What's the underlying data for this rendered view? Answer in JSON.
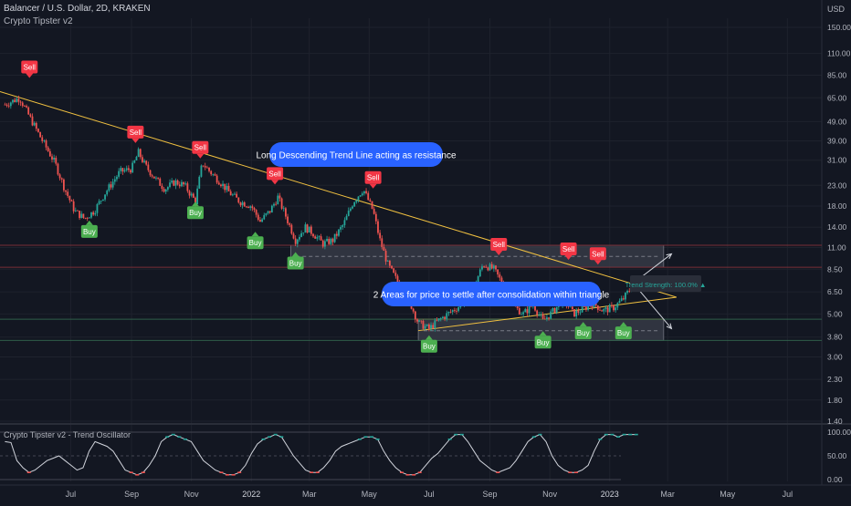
{
  "header": {
    "symbol_line": "Balancer / U.S. Dollar, 2D, KRAKEN",
    "indicator": "Crypto Tipster v2",
    "currency": "USD"
  },
  "oscillator": {
    "title": "Crypto Tipster v2 - Trend Oscillator",
    "ticks": [
      "100.00",
      "50.00",
      "0.00"
    ],
    "values": [
      80,
      78,
      40,
      25,
      15,
      20,
      30,
      40,
      45,
      50,
      40,
      30,
      20,
      25,
      60,
      80,
      75,
      70,
      60,
      40,
      20,
      15,
      10,
      15,
      30,
      50,
      80,
      90,
      95,
      90,
      85,
      80,
      60,
      40,
      30,
      20,
      15,
      10,
      10,
      15,
      30,
      55,
      75,
      85,
      90,
      95,
      90,
      70,
      50,
      35,
      20,
      15,
      15,
      25,
      40,
      60,
      70,
      75,
      80,
      85,
      90,
      90,
      85,
      60,
      40,
      25,
      15,
      10,
      10,
      15,
      30,
      45,
      55,
      70,
      85,
      95,
      95,
      80,
      60,
      40,
      30,
      20,
      15,
      20,
      25,
      40,
      60,
      80,
      90,
      95,
      80,
      50,
      30,
      20,
      15,
      15,
      20,
      30,
      60,
      85,
      95,
      95,
      90,
      95,
      95,
      95
    ]
  },
  "annotations": {
    "resistance_note": "Long Descending Trend Line acting as resistance",
    "areas_note": "2 Areas for price to settle after consolidation within triangle",
    "trend_strength": "Trend Strength: 100.0% ▲"
  },
  "signals": [
    {
      "label": "Sell",
      "color": "#f23645",
      "date": "2021-05-20",
      "price": 78
    },
    {
      "label": "Buy",
      "color": "#4caf50",
      "date": "2021-07-20",
      "price": 16
    },
    {
      "label": "Sell",
      "color": "#f23645",
      "date": "2021-09-05",
      "price": 36
    },
    {
      "label": "Sell",
      "color": "#f23645",
      "date": "2021-11-10",
      "price": 30
    },
    {
      "label": "Buy",
      "color": "#4caf50",
      "date": "2021-11-05",
      "price": 20
    },
    {
      "label": "Buy",
      "color": "#4caf50",
      "date": "2022-01-05",
      "price": 14
    },
    {
      "label": "Sell",
      "color": "#f23645",
      "date": "2022-01-25",
      "price": 22
    },
    {
      "label": "Buy",
      "color": "#4caf50",
      "date": "2022-02-15",
      "price": 11
    },
    {
      "label": "Sell",
      "color": "#f23645",
      "date": "2022-05-05",
      "price": 21
    },
    {
      "label": "Buy",
      "color": "#4caf50",
      "date": "2022-07-01",
      "price": 4.1
    },
    {
      "label": "Sell",
      "color": "#f23645",
      "date": "2022-09-10",
      "price": 9.5
    },
    {
      "label": "Buy",
      "color": "#4caf50",
      "date": "2022-10-25",
      "price": 4.3
    },
    {
      "label": "Sell",
      "color": "#f23645",
      "date": "2022-11-20",
      "price": 9
    },
    {
      "label": "Buy",
      "color": "#4caf50",
      "date": "2022-12-05",
      "price": 4.8
    },
    {
      "label": "Sell",
      "color": "#f23645",
      "date": "2022-12-20",
      "price": 8.5
    },
    {
      "label": "Buy",
      "color": "#4caf50",
      "date": "2023-01-15",
      "price": 4.8
    }
  ],
  "chart_data": {
    "type": "candlestick",
    "x_axis_labels": [
      "Jul",
      "Sep",
      "Nov",
      "2022",
      "Mar",
      "May",
      "Jul",
      "Sep",
      "Nov",
      "2023",
      "Mar",
      "May",
      "Jul"
    ],
    "y_axis_ticks": [
      "150.00",
      "110.00",
      "85.00",
      "65.00",
      "49.00",
      "39.00",
      "31.00",
      "23.00",
      "18.00",
      "14.00",
      "11.00",
      "8.50",
      "6.50",
      "5.00",
      "3.80",
      "3.00",
      "2.30",
      "1.80",
      "1.40"
    ],
    "y_scale": "log",
    "ylim": [
      1.4,
      150
    ],
    "price_path": [
      [
        "2021-04-25",
        60
      ],
      [
        "2021-05-10",
        65
      ],
      [
        "2021-05-20",
        52
      ],
      [
        "2021-06-01",
        40
      ],
      [
        "2021-06-15",
        30
      ],
      [
        "2021-06-25",
        22
      ],
      [
        "2021-07-05",
        17
      ],
      [
        "2021-07-15",
        15.5
      ],
      [
        "2021-07-25",
        17
      ],
      [
        "2021-08-05",
        21
      ],
      [
        "2021-08-20",
        27
      ],
      [
        "2021-09-01",
        28
      ],
      [
        "2021-09-08",
        34
      ],
      [
        "2021-09-15",
        29
      ],
      [
        "2021-09-25",
        25
      ],
      [
        "2021-10-05",
        22
      ],
      [
        "2021-10-15",
        24
      ],
      [
        "2021-10-25",
        23
      ],
      [
        "2021-11-05",
        19
      ],
      [
        "2021-11-12",
        30
      ],
      [
        "2021-11-20",
        27
      ],
      [
        "2021-11-30",
        24
      ],
      [
        "2021-12-10",
        21
      ],
      [
        "2021-12-20",
        19
      ],
      [
        "2022-01-01",
        18
      ],
      [
        "2022-01-10",
        15
      ],
      [
        "2022-01-20",
        17
      ],
      [
        "2022-01-28",
        20
      ],
      [
        "2022-02-05",
        16
      ],
      [
        "2022-02-15",
        12
      ],
      [
        "2022-02-25",
        14
      ],
      [
        "2022-03-05",
        13
      ],
      [
        "2022-03-15",
        11.5
      ],
      [
        "2022-03-25",
        12
      ],
      [
        "2022-04-05",
        14.5
      ],
      [
        "2022-04-15",
        19
      ],
      [
        "2022-04-25",
        22
      ],
      [
        "2022-05-05",
        17
      ],
      [
        "2022-05-12",
        12
      ],
      [
        "2022-05-20",
        9
      ],
      [
        "2022-06-01",
        7
      ],
      [
        "2022-06-10",
        6
      ],
      [
        "2022-06-20",
        4.5
      ],
      [
        "2022-07-01",
        4.2
      ],
      [
        "2022-07-10",
        4.6
      ],
      [
        "2022-07-20",
        5
      ],
      [
        "2022-08-01",
        5.5
      ],
      [
        "2022-08-15",
        6.8
      ],
      [
        "2022-08-25",
        9
      ],
      [
        "2022-09-05",
        8.5
      ],
      [
        "2022-09-15",
        7
      ],
      [
        "2022-09-25",
        5.5
      ],
      [
        "2022-10-05",
        5
      ],
      [
        "2022-10-15",
        5.6
      ],
      [
        "2022-10-25",
        4.6
      ],
      [
        "2022-11-05",
        5.2
      ],
      [
        "2022-11-15",
        6
      ],
      [
        "2022-11-25",
        5
      ],
      [
        "2022-12-05",
        5.3
      ],
      [
        "2022-12-15",
        5.7
      ],
      [
        "2022-12-25",
        5.2
      ],
      [
        "2023-01-05",
        5.4
      ],
      [
        "2023-01-15",
        6
      ],
      [
        "2023-01-25",
        7.1
      ]
    ]
  }
}
